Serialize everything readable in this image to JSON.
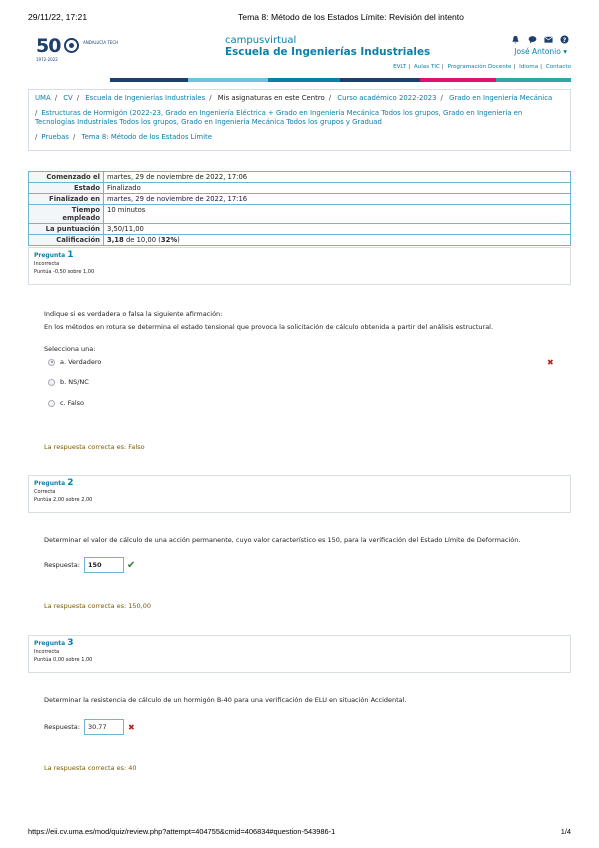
{
  "print_header": {
    "date": "29/11/22, 17:21",
    "title": "Tema 8: Método de los Estados Límite: Revisión del intento"
  },
  "logo": {
    "number": "50",
    "sub": "1972-2022",
    "seal_text": "ANDALUCÍA TECH"
  },
  "brand": {
    "line1": "campusvirtual",
    "line2": "Escuela de Ingenierías Industriales"
  },
  "user": {
    "name": "José Antonio ▾",
    "icons": [
      "bell-icon",
      "chat-icon",
      "mail-icon",
      "help-icon"
    ]
  },
  "links": [
    "EVLT",
    "Aulas TIC",
    "Programación Docente",
    "Idioma",
    "Contacto"
  ],
  "colors": {
    "accent": "#0a7fa8",
    "navy": "#1c3f6e",
    "bar": [
      "#1c3f6e",
      "#0a7fa8",
      "#6fc3e0",
      "#e0106f",
      "#2fa7a3"
    ]
  },
  "breadcrumb": {
    "line1": [
      {
        "t": "UMA",
        "link": true
      },
      {
        "t": "CV",
        "link": true
      },
      {
        "t": "Escuela de Ingenierías Industriales",
        "link": true
      },
      {
        "t": "Mis asignaturas en este Centro",
        "link": false
      },
      {
        "t": "Curso académico 2022-2023",
        "link": true
      },
      {
        "t": "Grado en Ingeniería Mecánica",
        "link": true
      }
    ],
    "line2": "Estructuras de Hormigón (2022-23, Grado en Ingeniería Eléctrica + Grado en Ingeniería Mecánica Todos los grupos, Grado en Ingeniería en Tecnologías Industriales Todos los grupos, Grado en Ingeniería Mecánica Todos los grupos y Graduad",
    "line3": [
      {
        "t": "Pruebas"
      },
      {
        "t": "Tema 8: Método de los Estados Límite"
      }
    ]
  },
  "summary": [
    {
      "k": "Comenzado el",
      "v": "martes, 29 de noviembre de 2022, 17:06"
    },
    {
      "k": "Estado",
      "v": "Finalizado"
    },
    {
      "k": "Finalizado en",
      "v": "martes, 29 de noviembre de 2022, 17:16"
    },
    {
      "k": "Tiempo empleado",
      "v": "10 minutos"
    },
    {
      "k": "La puntuación",
      "v": "3,50/11,00"
    },
    {
      "k": "Calificación",
      "v_bold": "3,18",
      "v_mid": " de 10,00 (",
      "v_pct": "32%",
      "v_end": ")"
    }
  ],
  "questions": [
    {
      "label": "Pregunta",
      "number": "1",
      "state": "Incorrecta",
      "points": "Puntúa -0,50 sobre 1,00",
      "prompt": "Indique si es verdadera o falsa la siguiente afirmación:",
      "statement": "En los métodos en rotura se determina el estado tensional que provoca la solicitación de cálculo obtenida a partir del análisis estructural.",
      "select_label": "Selecciona una:",
      "options": [
        "a. Verdadero",
        "b. NS/NC",
        "c. Falso"
      ],
      "feedback": "La respuesta correcta es: Falso"
    },
    {
      "label": "Pregunta",
      "number": "2",
      "state": "Correcta",
      "points": "Puntúa 2,00 sobre 2,00",
      "prompt": "Determinar el valor de cálculo de una acción permanente, cuyo valor característico es 150, para la verificación del Estado Límite de Deformación.",
      "answer_label": "Respuesta:",
      "answer": "150",
      "feedback": "La respuesta correcta es: 150,00"
    },
    {
      "label": "Pregunta",
      "number": "3",
      "state": "Incorrecta",
      "points": "Puntúa 0,00 sobre 1,00",
      "prompt": "Determinar la resistencia de cálculo de un hormigón B-40 para una verificación de ELU en situación Accidental.",
      "answer_label": "Respuesta:",
      "answer": "30.77",
      "feedback": "La respuesta correcta es: 40"
    }
  ],
  "footer": {
    "url": "https://eii.cv.uma.es/mod/quiz/review.php?attempt=404755&cmid=406834#question-543986-1",
    "page": "1/4"
  }
}
